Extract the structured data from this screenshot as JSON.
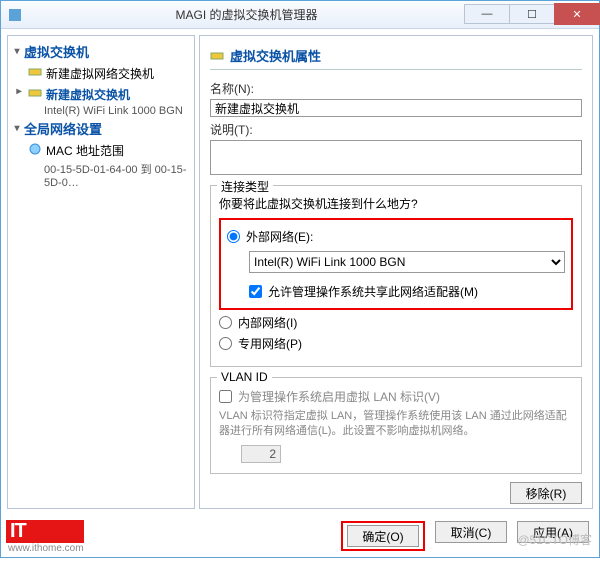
{
  "window": {
    "title": "MAGI 的虚拟交换机管理器",
    "min": "—",
    "max": "☐",
    "close": "✕"
  },
  "tree": {
    "group1": "虚拟交换机",
    "item1": "新建虚拟网络交换机",
    "item2": "新建虚拟交换机",
    "item2sub": "Intel(R) WiFi Link 1000 BGN",
    "group2": "全局网络设置",
    "item3": "MAC 地址范围",
    "item3sub": "00-15-5D-01-64-00 到 00-15-5D-0…"
  },
  "props": {
    "head": "虚拟交换机属性",
    "name_label": "名称(N):",
    "name_value": "新建虚拟交换机",
    "desc_label": "说明(T):",
    "desc_value": ""
  },
  "conn": {
    "group_title": "连接类型",
    "question": "你要将此虚拟交换机连接到什么地方?",
    "external": "外部网络(E):",
    "adapter": "Intel(R) WiFi Link 1000 BGN",
    "allow_share": "允许管理操作系统共享此网络适配器(M)",
    "internal": "内部网络(I)",
    "private": "专用网络(P)"
  },
  "vlan": {
    "group_title": "VLAN ID",
    "enable": "为管理操作系统启用虚拟 LAN 标识(V)",
    "help": "VLAN 标识符指定虚拟 LAN，管理操作系统使用该 LAN 通过此网络适配器进行所有网络通信(L)。此设置不影响虚拟机网络。",
    "value": "2"
  },
  "buttons": {
    "remove": "移除(R)",
    "ok": "确定(O)",
    "cancel": "取消(C)",
    "apply": "应用(A)"
  },
  "watermarks": {
    "brand": "IT",
    "brand_sub": "www.ithome.com",
    "right": "@51CTO博客"
  }
}
